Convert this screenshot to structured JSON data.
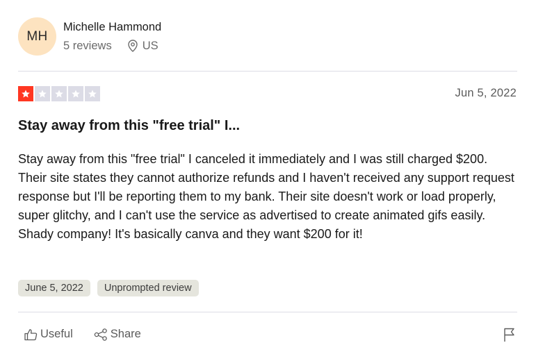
{
  "consumer": {
    "initials": "MH",
    "name": "Michelle Hammond",
    "reviews": "5 reviews",
    "country": "US",
    "avatar_color": "#fde3c0"
  },
  "review": {
    "rating": 1,
    "max_rating": 5,
    "star_color": "#ff3722",
    "star_empty_color": "#dcdce6",
    "date": "Jun 5, 2022",
    "title": "Stay away from this \"free trial\" I...",
    "body": "Stay away from this \"free trial\" I canceled it immediately and I was still charged $200. Their site states they cannot authorize refunds and I haven't received any support request response but I'll be reporting them to my bank. Their site doesn't work or load properly, super glitchy, and I can't use the service as advertised to create animated gifs easily. Shady company! It's basically canva and they want $200 for it!",
    "tags": [
      "June 5, 2022",
      "Unprompted review"
    ]
  },
  "actions": {
    "useful_label": "Useful",
    "share_label": "Share",
    "useful_icon": "thumbs-up-icon",
    "share_icon": "share-icon",
    "flag_icon": "flag-icon"
  }
}
